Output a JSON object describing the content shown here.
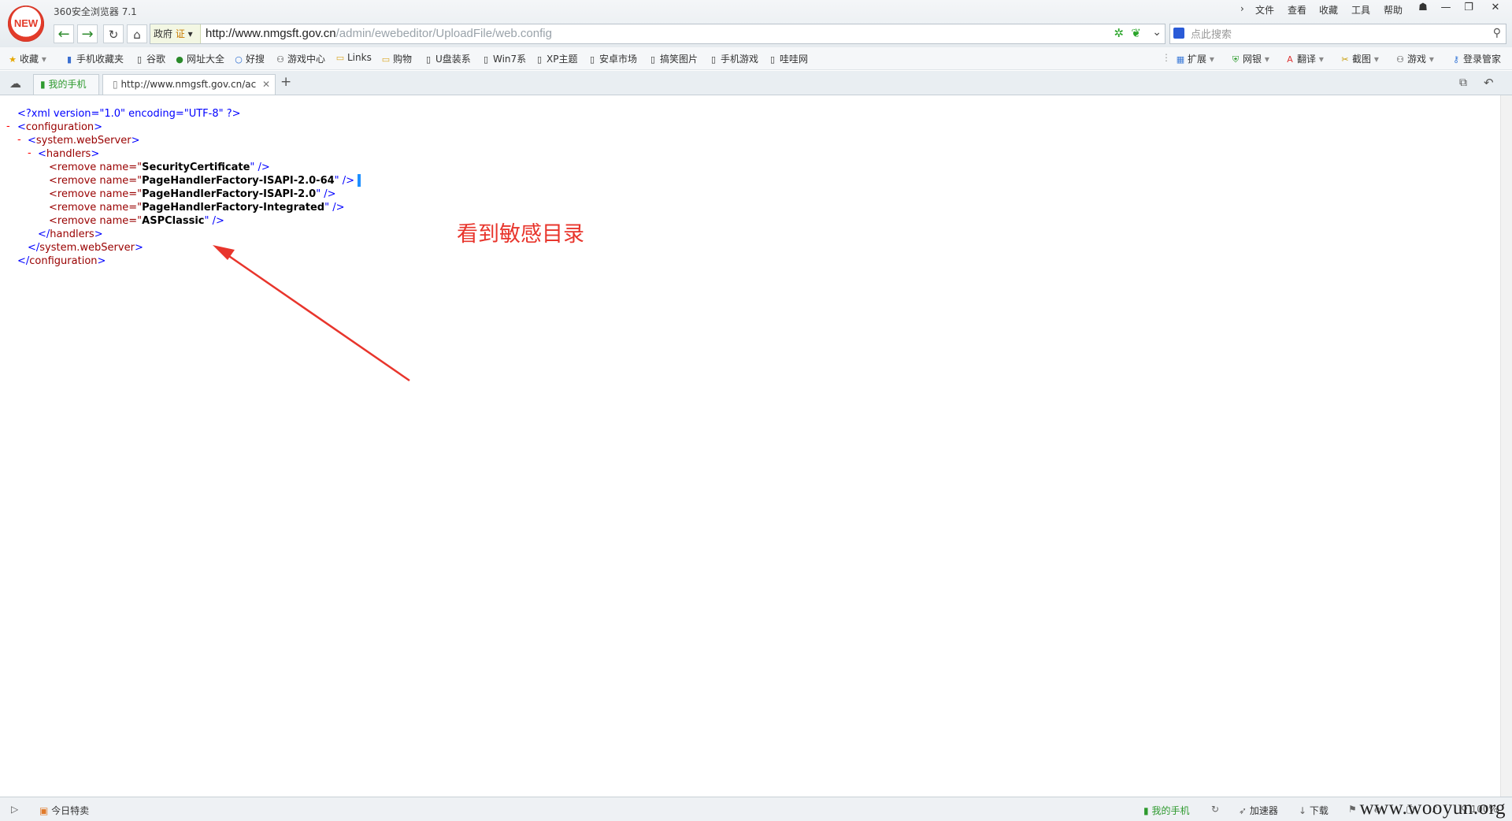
{
  "window": {
    "title": "360安全浏览器 7.1",
    "logo_text": "NEW",
    "menu": [
      "文件",
      "查看",
      "收藏",
      "工具",
      "帮助"
    ]
  },
  "nav": {
    "gov_label": "政府",
    "cert_label": "证",
    "url_host": "http://www.nmgsft.gov.cn",
    "url_path": "/admin/ewebeditor/UploadFile/web.config",
    "search_placeholder": "点此搜索"
  },
  "bookmarks": {
    "left": [
      "收藏",
      "手机收藏夹",
      "谷歌",
      "网址大全",
      "好搜",
      "游戏中心",
      "Links",
      "购物",
      "U盘装系",
      "Win7系",
      "XP主题",
      "安卓市场",
      "搞笑图片",
      "手机游戏",
      "哇哇网"
    ],
    "right": [
      "扩展",
      "网银",
      "翻译",
      "截图",
      "游戏",
      "登录管家"
    ]
  },
  "tabs": {
    "phone_tab": "我的手机",
    "active_tab": "http://www.nmgsft.gov.cn/ac",
    "new_tab_symbol": "+"
  },
  "xml": {
    "declaration": "<?xml version=\"1.0\" encoding=\"UTF-8\" ?>",
    "configuration": "configuration",
    "webserver": "system.webServer",
    "handlers": "handlers",
    "remove_tag": "<remove name=\"",
    "close_self": "\" />",
    "remove_names": [
      "SecurityCertificate",
      "PageHandlerFactory-ISAPI-2.0-64",
      "PageHandlerFactory-ISAPI-2.0",
      "PageHandlerFactory-Integrated",
      "ASPClassic"
    ],
    "toggle_symbol": "-"
  },
  "annotation": {
    "text": "看到敏感目录",
    "color": "#e8352c"
  },
  "status": {
    "left_toggle": "▷",
    "deals": "今日特卖",
    "my_phone": "我的手机",
    "accelerator": "加速器",
    "download": "下载",
    "zoom": "100%",
    "watermark": "www.wooyun.org"
  },
  "colors": {
    "xml_tag": "#990000",
    "xml_pi": "#0000ff",
    "xml_toggle": "#ff0000",
    "nav_green": "#2e8b2e"
  }
}
